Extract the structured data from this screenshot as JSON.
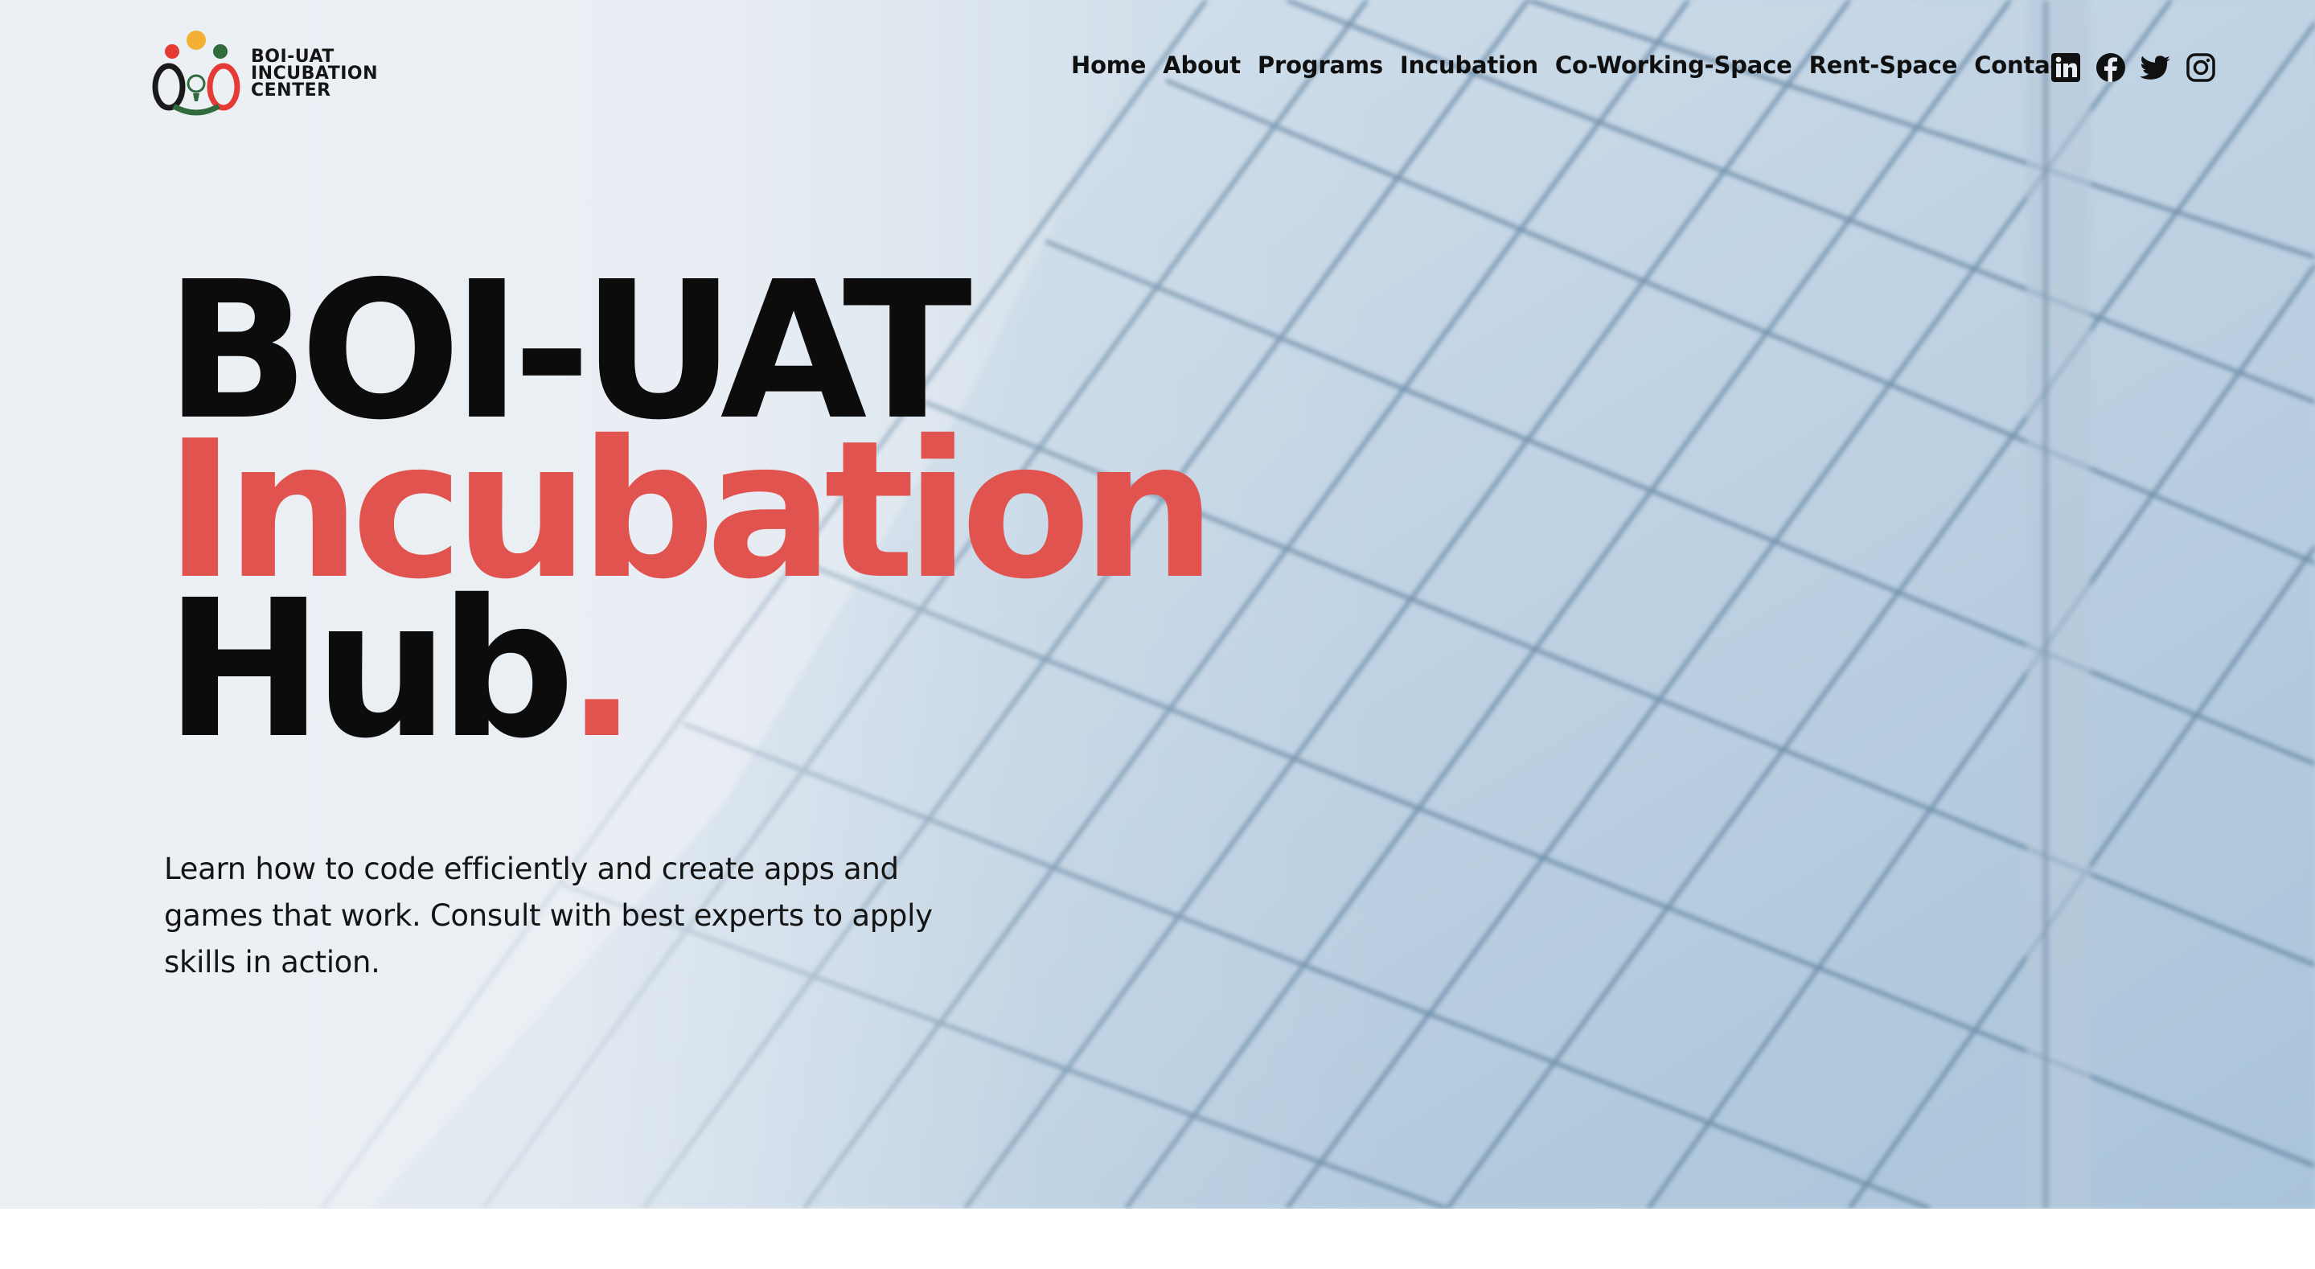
{
  "brand": {
    "logo_lines": [
      "BOI-UAT",
      "INCUBATION",
      "CENTER"
    ],
    "colors": {
      "accent_red": "#e0534f",
      "logo_red": "#e63a35",
      "logo_yellow": "#f2b134",
      "logo_green": "#2f6b3c",
      "logo_black": "#1a1a1a"
    }
  },
  "nav": {
    "items": [
      "Home",
      "About",
      "Programs",
      "Incubation",
      "Co-Working-Space",
      "Rent-Space",
      "Contact"
    ]
  },
  "social": {
    "icons": [
      "linkedin-icon",
      "facebook-icon",
      "twitter-icon",
      "instagram-icon"
    ]
  },
  "hero": {
    "title_line1": "BOI-UAT",
    "title_line2": "Incubation",
    "title_line3": "Hub",
    "title_dot": ".",
    "subtitle": "Learn how to code efficiently and create apps and games that work. Consult with best experts to apply skills in action."
  }
}
